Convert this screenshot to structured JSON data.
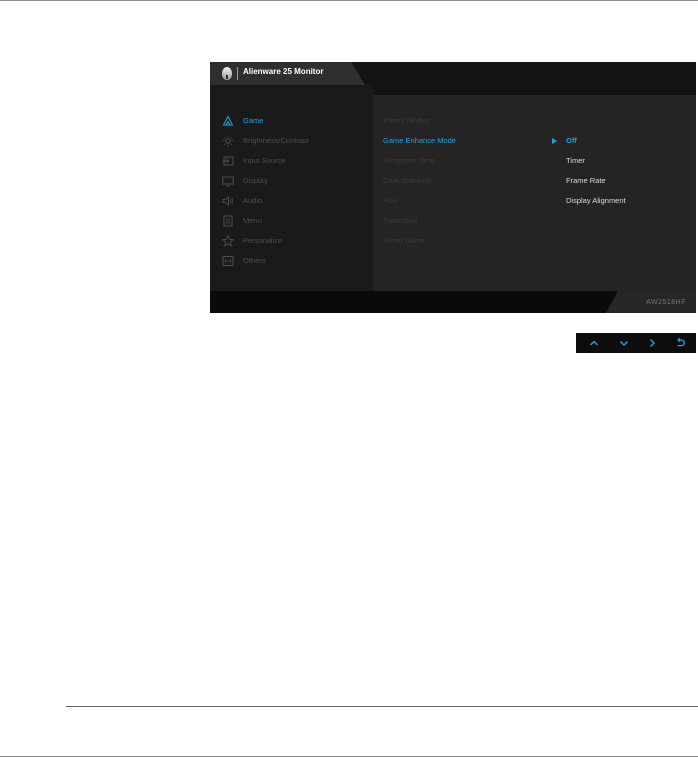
{
  "osd": {
    "title": "Alienware 25 Monitor",
    "model": "AW2518HF",
    "accent_color": "#1aa3e0",
    "menu": [
      {
        "label": "Game",
        "icon": "game-icon",
        "active": true
      },
      {
        "label": "Brightness/Contrast",
        "icon": "brightness-icon"
      },
      {
        "label": "Input Source",
        "icon": "input-source-icon"
      },
      {
        "label": "Display",
        "icon": "display-icon"
      },
      {
        "label": "Audio",
        "icon": "audio-icon"
      },
      {
        "label": "Menu",
        "icon": "menu-icon"
      },
      {
        "label": "Personalize",
        "icon": "star-icon"
      },
      {
        "label": "Others",
        "icon": "others-icon"
      }
    ],
    "submenu": [
      {
        "label": "Preset Modes"
      },
      {
        "label": "Game Enhance Mode",
        "active": true
      },
      {
        "label": "Response Time"
      },
      {
        "label": "Dark Stabilizer"
      },
      {
        "label": "Hue"
      },
      {
        "label": "Saturation"
      },
      {
        "label": "Reset Game"
      }
    ],
    "options": [
      {
        "label": "Off",
        "selected": true
      },
      {
        "label": "Timer"
      },
      {
        "label": "Frame Rate"
      },
      {
        "label": "Display Alignment"
      }
    ]
  },
  "controls": [
    {
      "name": "up-icon"
    },
    {
      "name": "down-icon"
    },
    {
      "name": "right-icon"
    },
    {
      "name": "back-icon"
    }
  ]
}
